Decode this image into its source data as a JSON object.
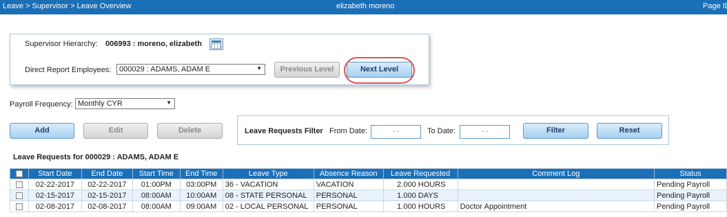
{
  "header": {
    "breadcrumb": "Leave > Supervisor > Leave Overview",
    "user_name": "elizabeth moreno",
    "page_id_label": "Page ID"
  },
  "hierarchy": {
    "label": "Supervisor Hierarchy:",
    "value": "006993 : moreno, elizabeth",
    "direct_report_label": "Direct Report Employees:",
    "direct_report_selected": "000029 : ADAMS, ADAM E",
    "previous_level_label": "Previous Level",
    "next_level_label": "Next Level"
  },
  "payroll": {
    "label": "Payroll Frequency:",
    "selected": "Monthly CYR"
  },
  "actions": {
    "add_label": "Add",
    "edit_label": "Edit",
    "delete_label": "Delete"
  },
  "filter": {
    "title": "Leave Requests Filter",
    "from_label": "From Date:",
    "from_value": "- -",
    "to_label": "To Date:",
    "to_value": "- -",
    "filter_label": "Filter",
    "reset_label": "Reset"
  },
  "requests": {
    "heading": "Leave Requests for 000029 : ADAMS, ADAM E",
    "columns": [
      "Start Date",
      "End Date",
      "Start Time",
      "End Time",
      "Leave Type",
      "Absence Reason",
      "Leave Requested",
      "Comment Log",
      "Status"
    ],
    "rows": [
      {
        "start_date": "02-22-2017",
        "end_date": "02-22-2017",
        "start_time": "01:00PM",
        "end_time": "03:00PM",
        "leave_type": "36 - VACATION",
        "absence_reason": "VACATION",
        "amount": "2.000",
        "unit": "HOURS",
        "comment": "",
        "status": "Pending Payroll"
      },
      {
        "start_date": "02-15-2017",
        "end_date": "02-15-2017",
        "start_time": "08:00AM",
        "end_time": "10:00AM",
        "leave_type": "08 - STATE PERSONAL",
        "absence_reason": "PERSONAL",
        "amount": "1.000",
        "unit": "DAYS",
        "comment": "",
        "status": "Pending Payroll"
      },
      {
        "start_date": "02-08-2017",
        "end_date": "02-08-2017",
        "start_time": "08:00AM",
        "end_time": "09:00AM",
        "leave_type": "02 - LOCAL PERSONAL",
        "absence_reason": "PERSONAL",
        "amount": "1.000",
        "unit": "HOURS",
        "comment": "Doctor Appointment",
        "status": "Pending Payroll"
      }
    ]
  }
}
